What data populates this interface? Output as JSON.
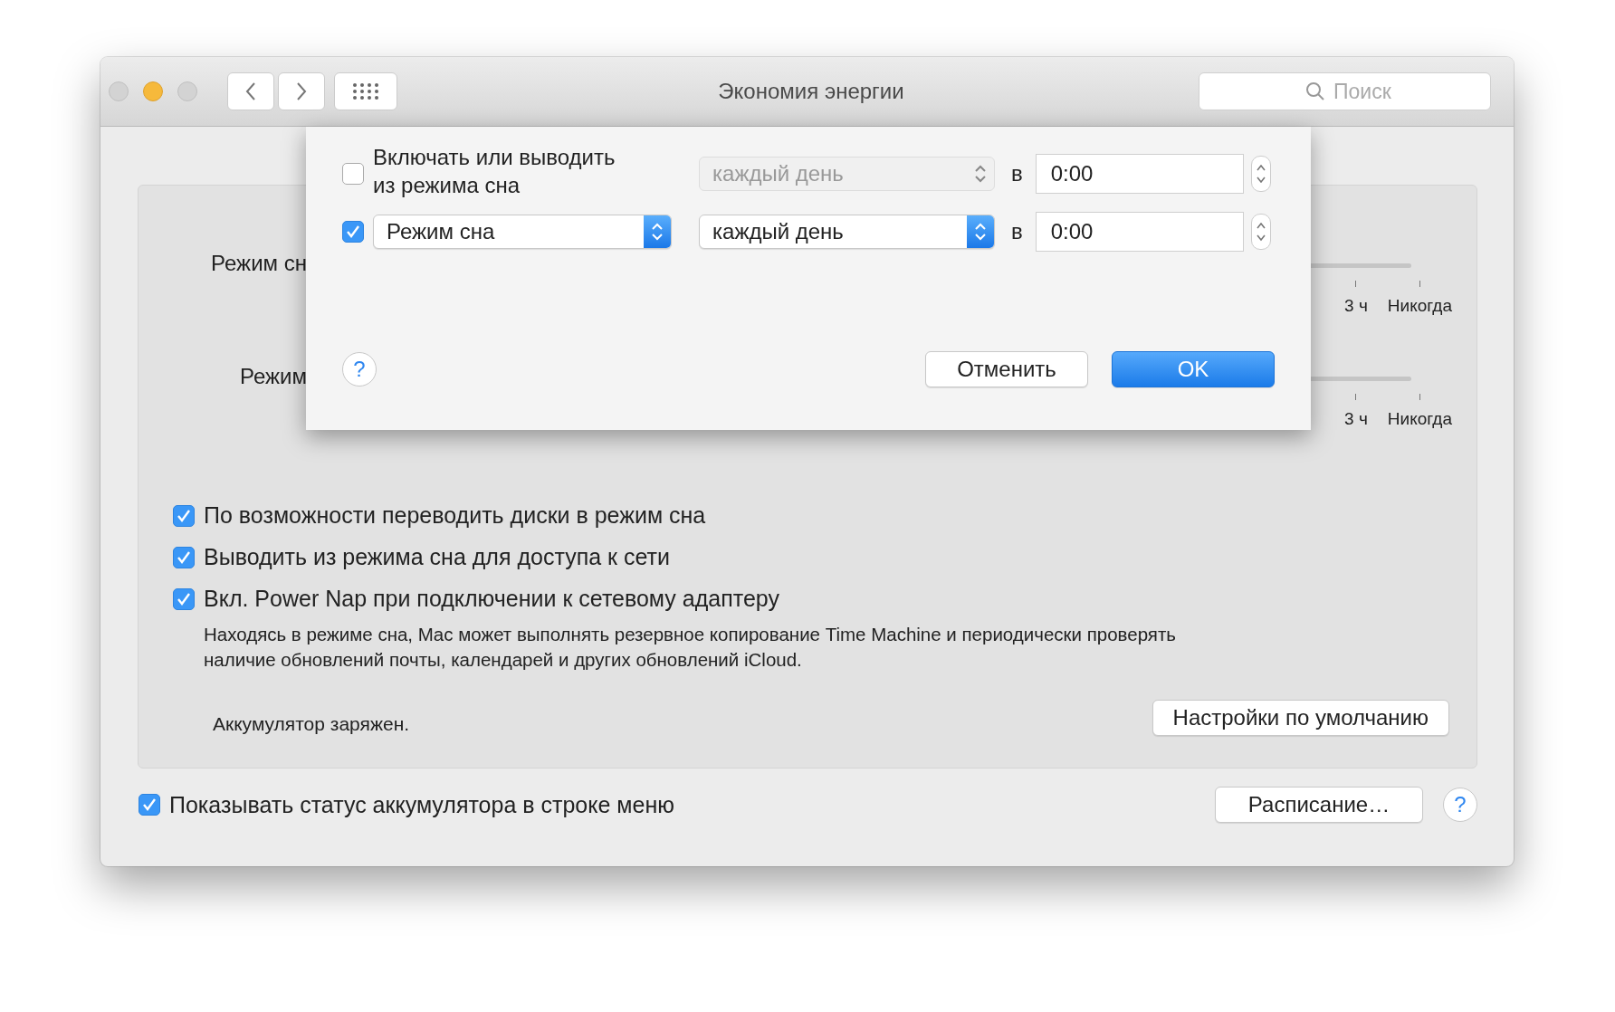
{
  "window": {
    "title": "Экономия энергии",
    "search": {
      "placeholder": "Поиск"
    }
  },
  "sliders": [
    {
      "label": "Режим сн",
      "ticks": [
        "3 ч",
        "Никогда"
      ]
    },
    {
      "label": "Режим",
      "ticks": [
        "3 ч",
        "Никогда"
      ]
    }
  ],
  "options": [
    {
      "label": "По возможности переводить диски в режим сна",
      "checked": true
    },
    {
      "label": "Выводить из режима сна для доступа к сети",
      "checked": true
    },
    {
      "label": "Вкл. Power Nap при подключении к сетевому адаптеру",
      "checked": true
    }
  ],
  "power_nap_note": "Находясь в режиме сна, Mac может выполнять резервное копирование Time Machine и периодически проверять наличие обновлений почты, календарей и других обновлений iCloud.",
  "battery_status": "Аккумулятор заряжен.",
  "defaults_button": "Настройки по умолчанию",
  "menu_bar_option": {
    "label": "Показывать статус аккумулятора в строке меню",
    "checked": true
  },
  "schedule_button": "Расписание…",
  "help_button": "?",
  "sheet": {
    "rows": [
      {
        "kind": "label",
        "checked": false,
        "action": "Включать или выводить из режима сна",
        "day": "каждый день",
        "at": "в",
        "time": "0:00"
      },
      {
        "kind": "popup",
        "checked": true,
        "action": "Режим сна",
        "day": "каждый день",
        "at": "в",
        "time": "0:00"
      }
    ],
    "help_button": "?",
    "cancel_button": "Отменить",
    "ok_button": "OK"
  }
}
